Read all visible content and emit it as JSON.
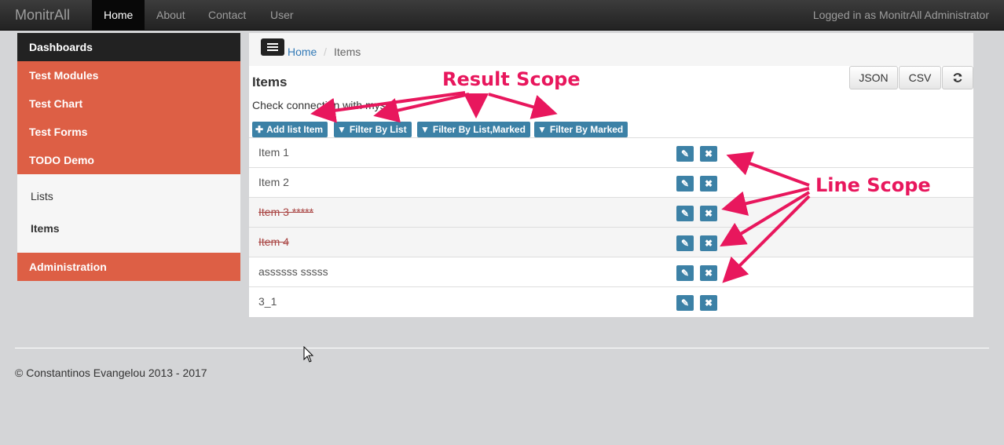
{
  "navbar": {
    "brand": "MonitrAll",
    "items": [
      {
        "label": "Home",
        "active": true
      },
      {
        "label": "About"
      },
      {
        "label": "Contact"
      },
      {
        "label": "User"
      }
    ],
    "user_status": "Logged in as MonitrAll Administrator"
  },
  "sidebar": {
    "header": "Dashboards",
    "red_items": [
      "Test Modules",
      "Test Chart",
      "Test Forms",
      "TODO Demo"
    ],
    "white_items": [
      {
        "label": "Lists",
        "bold": false
      },
      {
        "label": "Items",
        "bold": true
      }
    ],
    "admin": "Administration"
  },
  "breadcrumb": {
    "home": "Home",
    "separator": "/",
    "current": "Items"
  },
  "page": {
    "title": "Items",
    "description": "Check connection with mysql",
    "toolbar": {
      "json": "JSON",
      "csv": "CSV",
      "refresh_icon": "refresh-icon"
    },
    "actions": [
      {
        "icon": "plus-icon",
        "label": "Add list Item"
      },
      {
        "icon": "filter-icon",
        "label": "Filter By List"
      },
      {
        "icon": "filter-icon",
        "label": "Filter By List,Marked"
      },
      {
        "icon": "filter-icon",
        "label": "Filter By Marked"
      }
    ],
    "rows": [
      {
        "label": "Item 1",
        "marked": false
      },
      {
        "label": "Item 2",
        "marked": false
      },
      {
        "label": "Item 3 *****",
        "marked": true
      },
      {
        "label": "Item 4",
        "marked": true
      },
      {
        "label": "assssss sssss",
        "marked": false
      },
      {
        "label": "3_1",
        "marked": false
      }
    ],
    "row_actions": {
      "edit_icon": "pencil-icon",
      "delete_icon": "close-icon"
    }
  },
  "annotations": {
    "result_scope": "Result Scope",
    "line_scope": "Line Scope"
  },
  "footer": {
    "copyright": "© Constantinos Evangelou 2013 - 2017"
  },
  "colors": {
    "accent_red": "#dd5f45",
    "action_blue": "#3c81a6",
    "annotation_pink": "#e8175d"
  }
}
